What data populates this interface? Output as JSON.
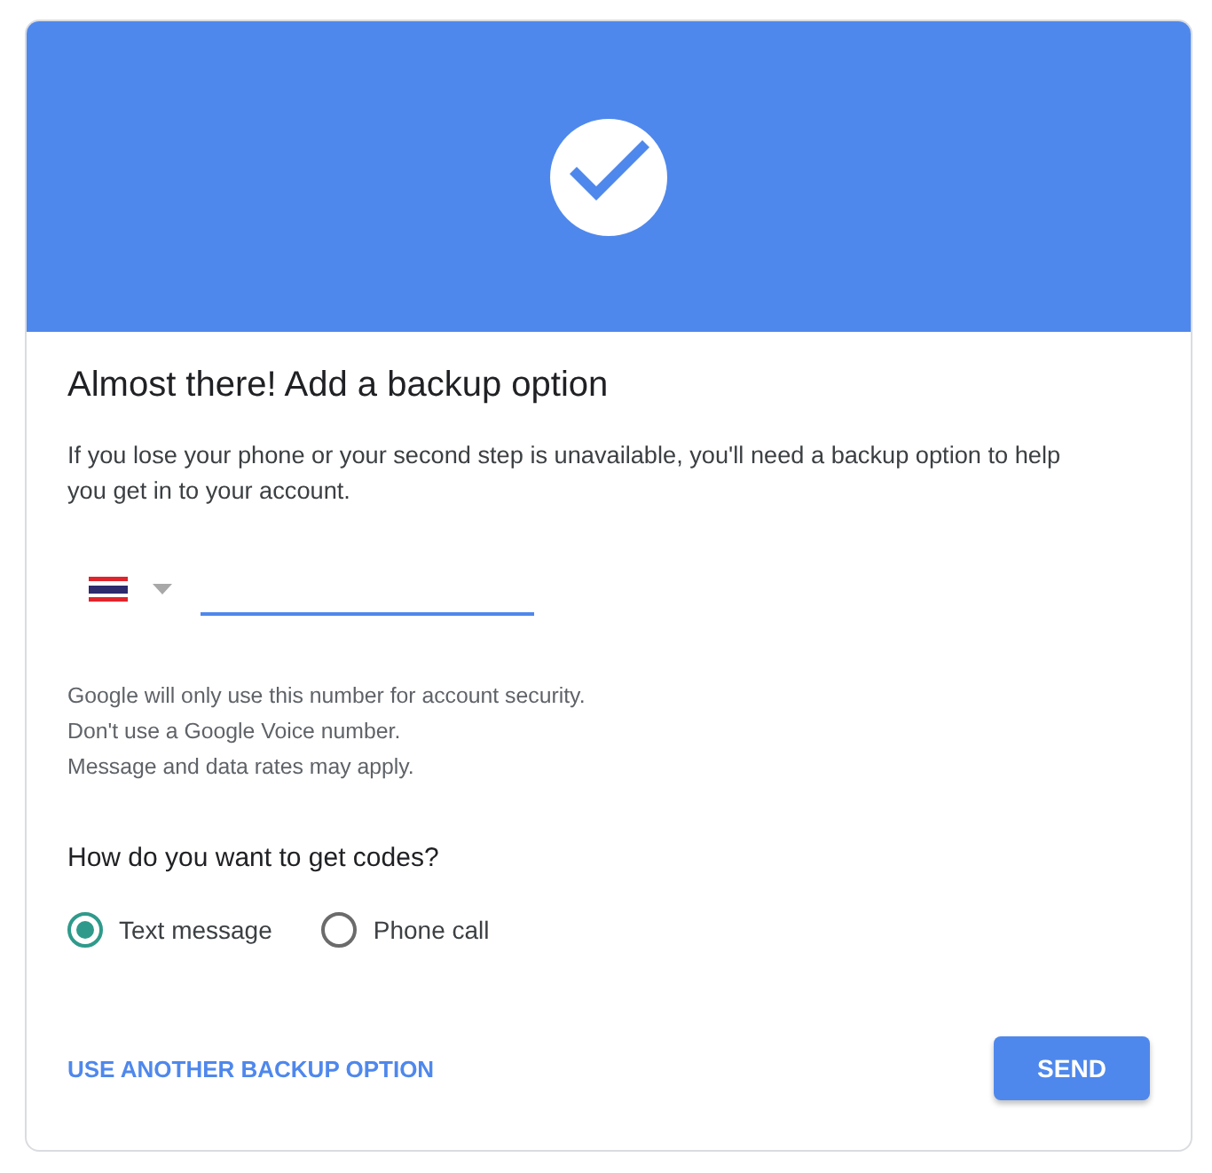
{
  "title": "Almost there! Add a backup option",
  "description": "If you lose your phone or your second step is unavailable, you'll need a backup option to help you get in to your account.",
  "phone_field": {
    "focused": true
  },
  "notes": [
    "Google will only use this number for account security.",
    "Don't use a Google Voice number.",
    "Message and data rates may apply."
  ],
  "question": "How do you want to get codes?",
  "options": [
    {
      "label": "Text message",
      "selected": true
    },
    {
      "label": "Phone call",
      "selected": false
    }
  ],
  "footer": {
    "link": "USE ANOTHER BACKUP OPTION",
    "button": "SEND"
  }
}
